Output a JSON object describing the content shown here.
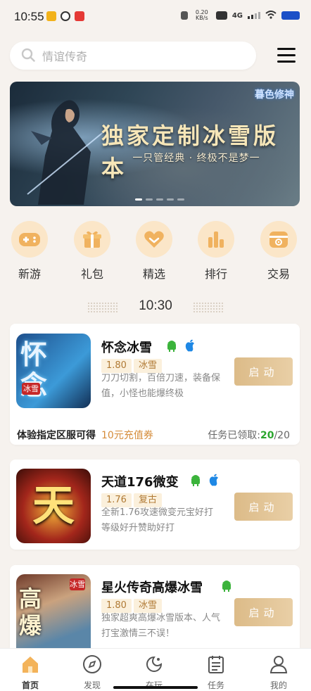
{
  "status_bar": {
    "time": "10:55",
    "net_speed": "0.20 KB/s",
    "network": "4G"
  },
  "search": {
    "placeholder": "情谊传奇"
  },
  "banner": {
    "title": "独家定制冰雪版本",
    "subtitle": "一只管经典 · 终极不是梦一",
    "logo": "暮色修神",
    "slides": 5,
    "active_slide": 1
  },
  "categories": [
    {
      "label": "新游",
      "icon": "gamepad-icon"
    },
    {
      "label": "礼包",
      "icon": "gift-icon"
    },
    {
      "label": "精选",
      "icon": "heart-icon"
    },
    {
      "label": "排行",
      "icon": "bar-chart-icon"
    },
    {
      "label": "交易",
      "icon": "trade-icon"
    }
  ],
  "section_time": "10:30",
  "games": [
    {
      "name": "怀念冰雪",
      "icon_text": "怀念",
      "icon_badge": "冰雪",
      "version": "1.80",
      "tag": "冰雪",
      "desc": "刀刀切割，百倍刀速，装备保值，小怪也能爆终极",
      "button": "启动",
      "platforms": [
        "android-icon",
        "apple-icon"
      ],
      "promo": "体验指定区服可得",
      "coupon": "10元充值券",
      "task_label": "任务已领取:",
      "task_done": "20",
      "task_total": "/20"
    },
    {
      "name": "天道176微变",
      "icon_text": "天",
      "version": "1.76",
      "tag": "复古",
      "desc": "全新1.76攻速微变元宝好打等级好升赞助好打",
      "button": "启动",
      "platforms": [
        "android-icon",
        "apple-icon"
      ]
    },
    {
      "name": "星火传奇高爆冰雪",
      "icon_text": "高爆",
      "icon_badge": "冰雪",
      "version": "1.80",
      "tag": "冰雪",
      "desc": "独家超爽高爆冰雪版本、人气打宝激情三不误！",
      "button": "启动",
      "platforms": [
        "android-icon"
      ]
    }
  ],
  "tabbar": [
    {
      "label": "首页",
      "icon": "home-icon",
      "active": true
    },
    {
      "label": "发现",
      "icon": "compass-icon"
    },
    {
      "label": "在玩",
      "icon": "playing-icon"
    },
    {
      "label": "任务",
      "icon": "task-list-icon"
    },
    {
      "label": "我的",
      "icon": "profile-icon"
    }
  ],
  "colors": {
    "accent": "#e2c290",
    "android": "#3bb33b",
    "apple": "#1e88e5",
    "coupon": "#d58c3a",
    "task_done": "#2aa52d"
  }
}
